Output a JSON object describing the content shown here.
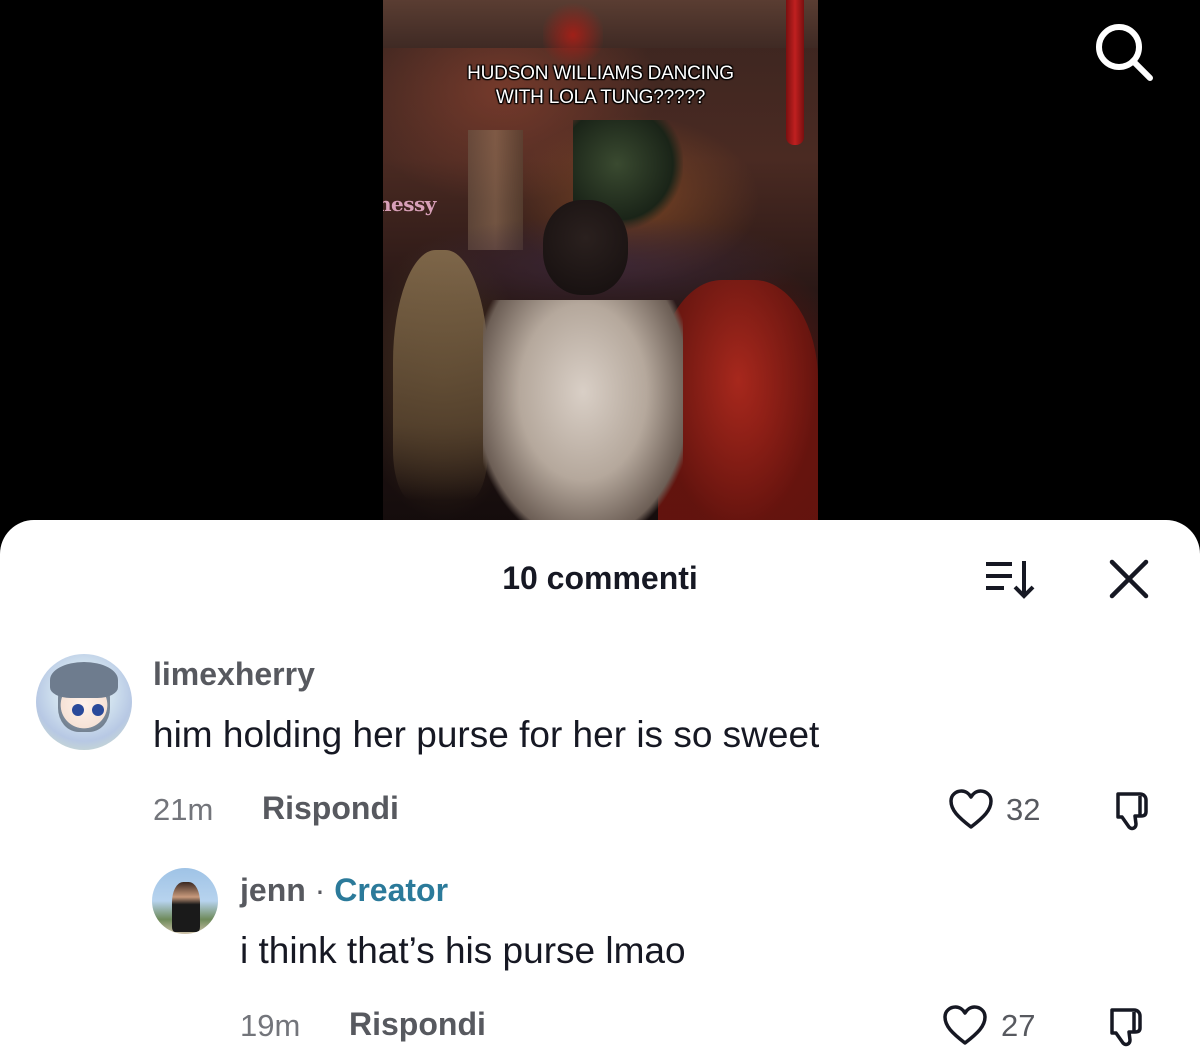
{
  "video": {
    "caption_line1": "HUDSON WILLIAMS DANCING",
    "caption_line2": "WITH LOLA TUNG?????",
    "background_sign": "nessy"
  },
  "header": {
    "search_icon": "search-icon"
  },
  "comments_sheet": {
    "title": "10 commenti",
    "sort_icon": "sort-icon",
    "close_icon": "close-icon",
    "comments": [
      {
        "username": "limexherry",
        "text": "him holding her purse for her is so sweet",
        "time": "21m",
        "reply_label": "Rispondi",
        "likes": "32"
      },
      {
        "username": "jenn",
        "separator": "·",
        "badge": "Creator",
        "text": "i think that’s his purse lmao",
        "time": "19m",
        "reply_label": "Rispondi",
        "likes": "27"
      }
    ]
  },
  "colors": {
    "sheet_background": "#ffffff",
    "creator_badge": "#2b7a9a",
    "text_primary": "#161823",
    "text_secondary": "#57595f"
  }
}
